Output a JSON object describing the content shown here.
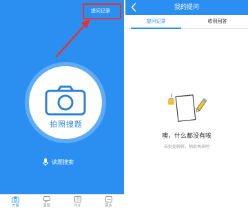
{
  "left": {
    "ask_record_label": "提问记录",
    "photo_search_label": "拍照搜题",
    "voice_search_label": "读题搜索",
    "bottom_nav": [
      {
        "label": "开题",
        "icon": "camera-icon",
        "active": true
      },
      {
        "label": "源题",
        "icon": "chat-icon",
        "active": false
      },
      {
        "label": "作文",
        "icon": "book-icon",
        "active": false
      },
      {
        "label": "更多",
        "icon": "more-icon",
        "active": false
      }
    ],
    "colors": {
      "background": "#2a8ff0",
      "highlight": "#e8322c"
    }
  },
  "right": {
    "title": "我的提问",
    "tabs": [
      {
        "label": "提问记录",
        "active": true
      },
      {
        "label": "收到回答",
        "active": false
      }
    ],
    "empty_title": "噢，什么都没有唉",
    "empty_subtitle": "去别处转转，稍后再来吧"
  }
}
